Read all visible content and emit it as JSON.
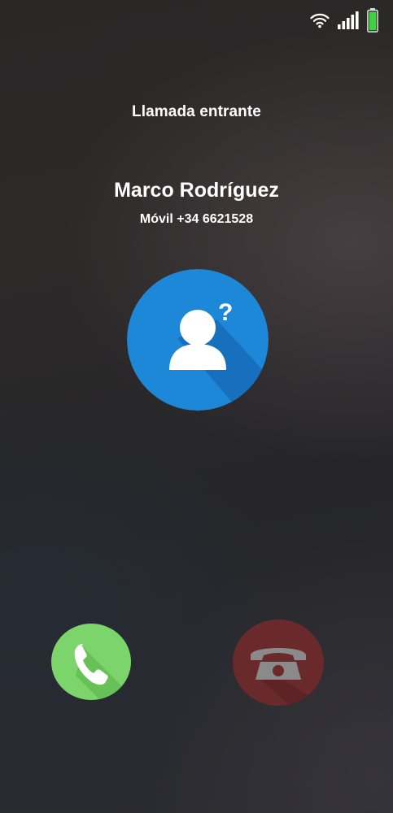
{
  "status_bar": {
    "wifi_icon": "wifi-icon",
    "signal_icon": "signal-bars-icon",
    "battery_icon": "battery-charging-icon",
    "battery_color": "#3fd23f"
  },
  "call": {
    "status_label": "Llamada entrante",
    "caller_name": "Marco Rodríguez",
    "caller_number": "Móvil +34 6621528"
  },
  "avatar": {
    "icon": "unknown-caller-icon",
    "color": "#1e88d8"
  },
  "actions": {
    "accept": {
      "icon": "phone-handset-icon",
      "color": "#7bd56a"
    },
    "decline": {
      "icon": "rotary-phone-icon",
      "color": "#6a2a2c"
    }
  }
}
